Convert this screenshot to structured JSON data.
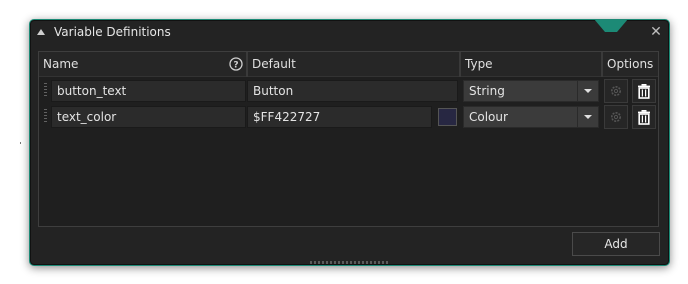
{
  "window": {
    "title": "Variable Definitions"
  },
  "table": {
    "headers": {
      "name": "Name",
      "default": "Default",
      "type": "Type",
      "options": "Options"
    },
    "rows": [
      {
        "name": "button_text",
        "default": "Button",
        "type": "String",
        "swatch": null
      },
      {
        "name": "text_color",
        "default": "$FF422727",
        "type": "Colour",
        "swatch": "#272742"
      }
    ]
  },
  "footer": {
    "add_label": "Add"
  },
  "colors": {
    "accent": "#1c8a76",
    "background": "#232323"
  }
}
